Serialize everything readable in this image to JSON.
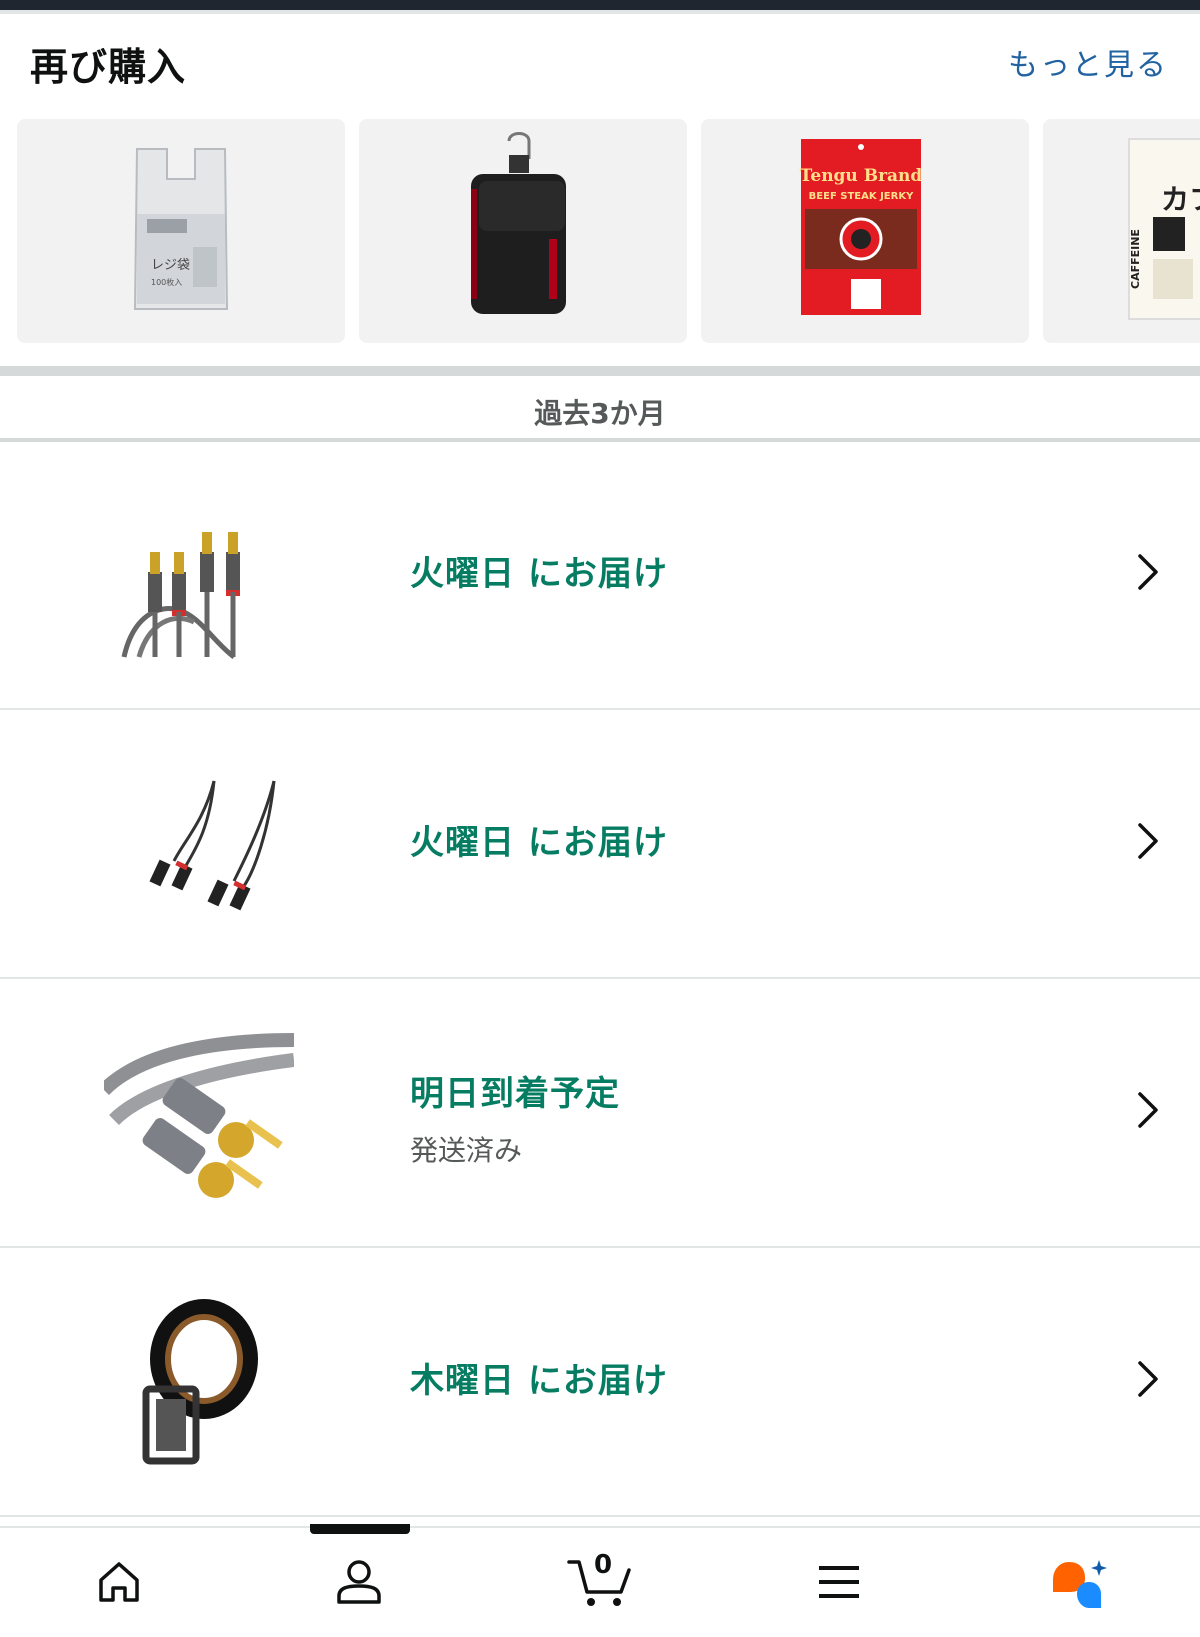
{
  "buy_again": {
    "title": "再び購入",
    "see_more": "もっと見る",
    "products": [
      {
        "label": "レジ袋",
        "sub": "100枚入",
        "icon": "plastic-bag-product"
      },
      {
        "label": "",
        "icon": "belt-pouch-product"
      },
      {
        "label": "Tengu Brand",
        "sub": "BEEF STEAK JERKY",
        "icon": "beef-jerky-product"
      },
      {
        "label": "カフェ",
        "sub": "CAFFEINE",
        "icon": "caffeine-supplement-product"
      }
    ]
  },
  "section": {
    "title": "過去3か月"
  },
  "orders": [
    {
      "status": "火曜日 にお届け",
      "sub": "",
      "icon": "rca-cable-gray-icon"
    },
    {
      "status": "火曜日 にお届け",
      "sub": "",
      "icon": "rca-cable-black-icon"
    },
    {
      "status": "明日到着予定",
      "sub": "発送済み",
      "icon": "rca-cable-gold-icon"
    },
    {
      "status": "木曜日 にお届け",
      "sub": "",
      "icon": "leather-belt-icon"
    }
  ],
  "bottom_nav": {
    "cart_count": "0",
    "items": [
      "home-icon",
      "account-icon",
      "cart-icon",
      "menu-icon",
      "rufus-icon"
    ]
  },
  "colors": {
    "link_blue": "#2162a1",
    "status_green": "#067d62",
    "rufus_orange": "#ff6200",
    "rufus_blue": "#1a8cff"
  }
}
